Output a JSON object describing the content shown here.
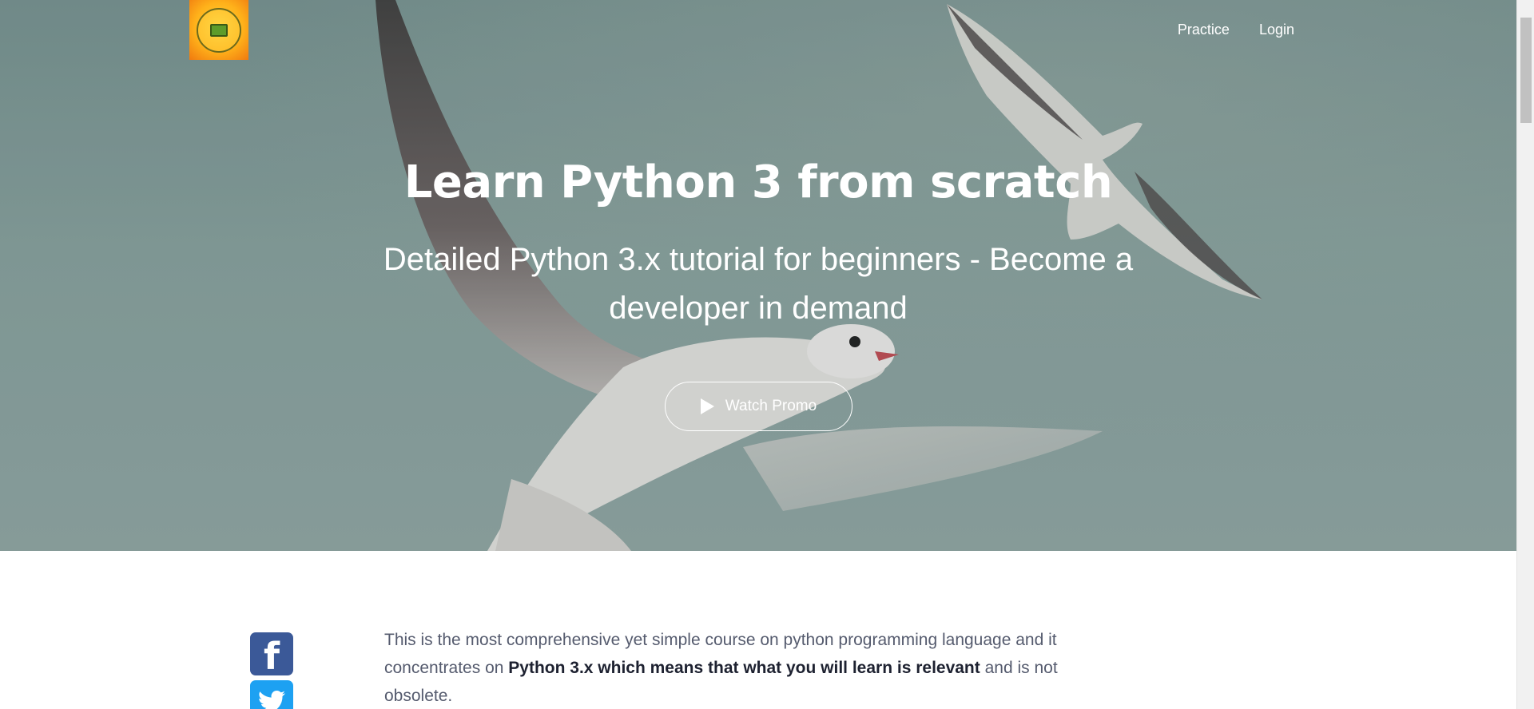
{
  "nav": {
    "practice": "Practice",
    "login": "Login"
  },
  "hero": {
    "title": "Learn Python 3 from scratch",
    "subtitle": "Detailed Python 3.x tutorial for beginners - Become a developer in demand",
    "promo_button": "Watch Promo"
  },
  "social": {
    "facebook_glyph": "f"
  },
  "intro": {
    "part1": "This is the most comprehensive yet simple course on python programming language and it concentrates on ",
    "bold": "Python 3.x which means that what you will learn is relevant",
    "part2": " and is not obsolete."
  },
  "icons": {
    "logo": "logo-icon",
    "play": "play-icon",
    "facebook": "facebook-icon",
    "twitter": "twitter-icon"
  },
  "colors": {
    "facebook": "#3b5998",
    "twitter": "#1da1f2",
    "hero_text": "#ffffff",
    "body_text": "#555b6e",
    "body_bold": "#1d2130"
  }
}
